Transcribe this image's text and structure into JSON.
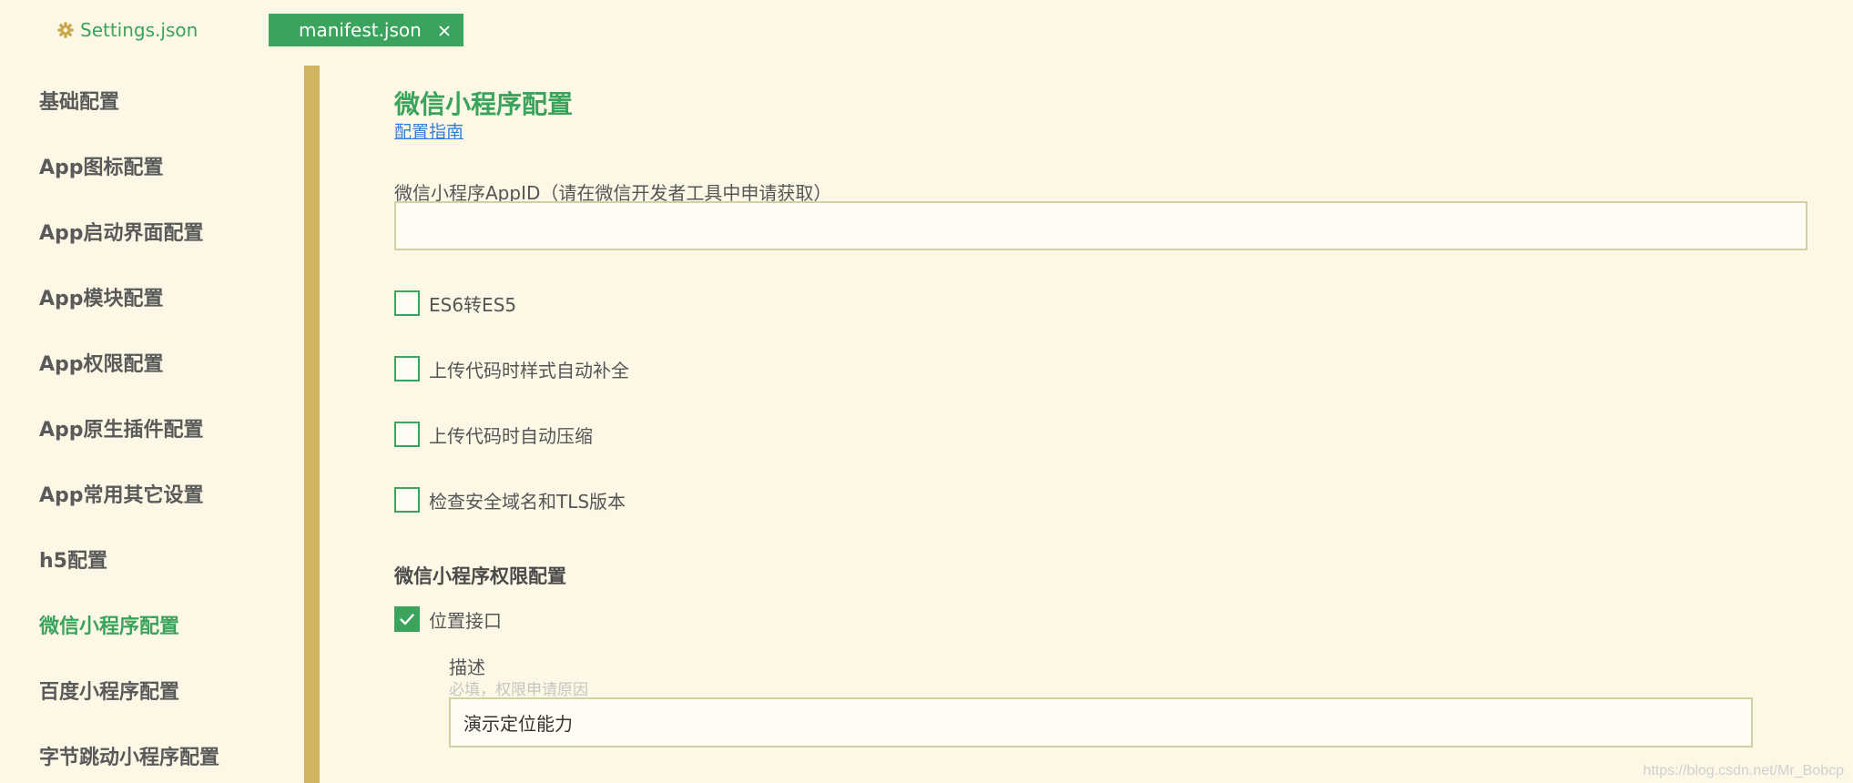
{
  "tabs": {
    "settings": {
      "label": "Settings.json",
      "icon": "gear-icon"
    },
    "manifest": {
      "label": "manifest.json",
      "close_icon": "close-icon",
      "active": true
    }
  },
  "sidebar": {
    "items": [
      {
        "label": "基础配置"
      },
      {
        "label": "App图标配置"
      },
      {
        "label": "App启动界面配置"
      },
      {
        "label": "App模块配置"
      },
      {
        "label": "App权限配置"
      },
      {
        "label": "App原生插件配置"
      },
      {
        "label": "App常用其它设置"
      },
      {
        "label": "h5配置"
      },
      {
        "label": "微信小程序配置",
        "active": true
      },
      {
        "label": "百度小程序配置"
      },
      {
        "label": "字节跳动小程序配置"
      }
    ]
  },
  "main": {
    "title": "微信小程序配置",
    "guide_link": "配置指南",
    "appid": {
      "label": "微信小程序AppID（请在微信开发者工具中申请获取）",
      "value": ""
    },
    "options": [
      {
        "label": "ES6转ES5",
        "checked": false
      },
      {
        "label": "上传代码时样式自动补全",
        "checked": false
      },
      {
        "label": "上传代码时自动压缩",
        "checked": false
      },
      {
        "label": "检查安全域名和TLS版本",
        "checked": false
      }
    ],
    "permissions": {
      "title": "微信小程序权限配置",
      "location": {
        "label": "位置接口",
        "checked": true
      },
      "description": {
        "label": "描述",
        "hint": "必填，权限申请原因",
        "value": "演示定位能力"
      }
    }
  },
  "watermark": "https://blog.csdn.net/Mr_Bobcp",
  "colors": {
    "background": "#fdf8e6",
    "accent": "#3aa35c",
    "divider": "#d2b35f",
    "link": "#2f7fd6",
    "input_border": "#cfd2a6",
    "gear": "#c8a84a"
  }
}
